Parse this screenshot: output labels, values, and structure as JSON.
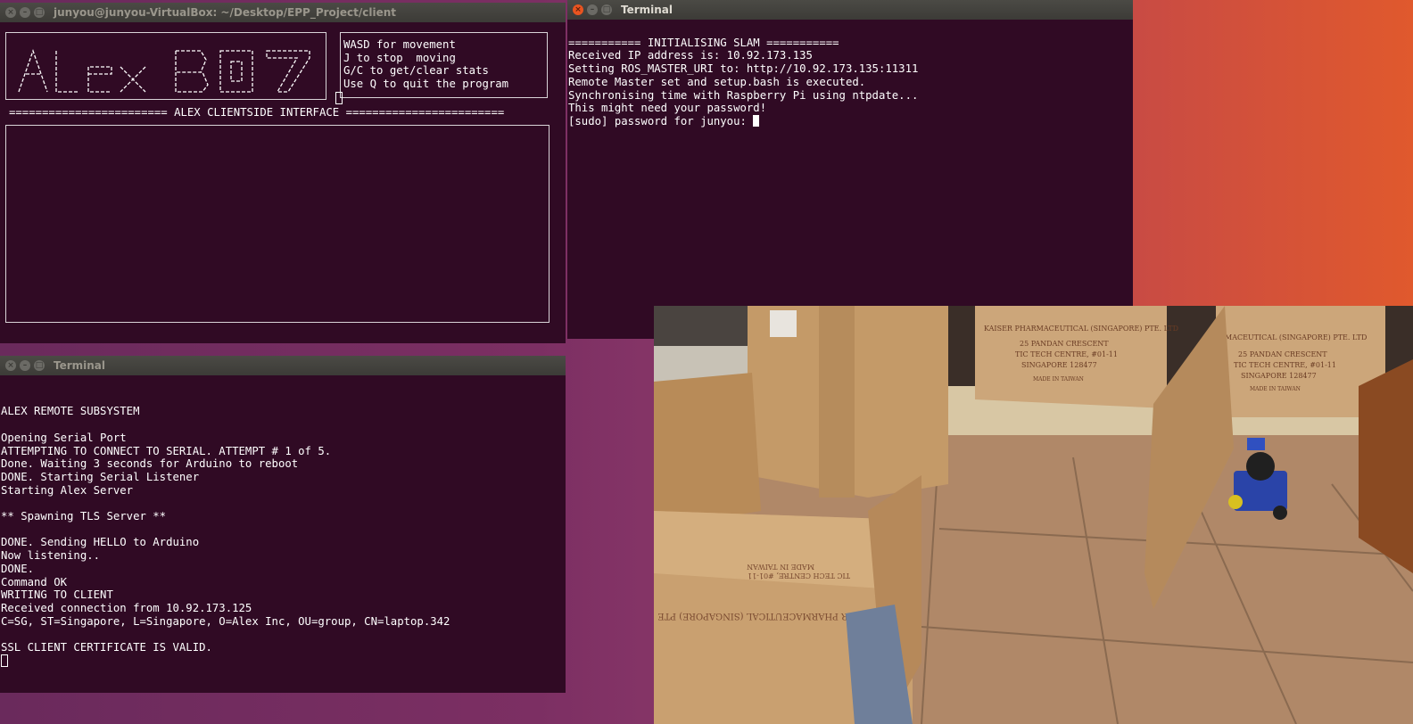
{
  "client_window": {
    "title": "junyou@junyou-VirtualBox: ~/Desktop/EPP_Project/client",
    "banner_ascii": [
      " ___  __            ___  ___  ___ ",
      "/ _ \\|  |   ___ _ _|_  )|   ||_  )",
      "| |_| |  |__/ -_) \\ // / | O | / / ",
      "|_| |_|____\\___/_\\_\\/___||___|/___|"
    ],
    "banner_text": "Alex B07",
    "help_lines": [
      "WASD for movement",
      "J to stop  moving",
      "G/C to get/clear stats",
      "Use Q to quit the program"
    ],
    "interface_header": "======================== ALEX CLIENTSIDE INTERFACE ========================"
  },
  "slam_window": {
    "title": "Terminal",
    "lines": [
      "=========== INITIALISING SLAM ===========",
      "Received IP address is: 10.92.173.135",
      "Setting ROS_MASTER_URI to: http://10.92.173.135:11311",
      "Remote Master set and setup.bash is executed.",
      "Synchronising time with Raspberry Pi using ntpdate...",
      "This might need your password!"
    ],
    "prompt": "[sudo] password for junyou: "
  },
  "server_window": {
    "title": "Terminal",
    "lines": [
      "",
      "ALEX REMOTE SUBSYSTEM",
      "",
      "Opening Serial Port",
      "ATTEMPTING TO CONNECT TO SERIAL. ATTEMPT # 1 of 5.",
      "Done. Waiting 3 seconds for Arduino to reboot",
      "DONE. Starting Serial Listener",
      "Starting Alex Server",
      "",
      "** Spawning TLS Server **",
      "",
      "DONE. Sending HELLO to Arduino",
      "Now listening..",
      "DONE.",
      "Command OK",
      "WRITING TO CLIENT",
      "Received connection from 10.92.173.125",
      "C=SG, ST=Singapore, L=Singapore, O=Alex Inc, OU=group, CN=laptop.342",
      "",
      "SSL CLIENT CERTIFICATE IS VALID."
    ]
  },
  "camera_feed": {
    "box_texts": [
      "KAISER PHARMACEUTICAL (SINGAPORE) PTE. LTD",
      "25 PANDAN CRESCENT",
      "TIC TECH CENTRE, #01-11",
      "SINGAPORE 128477",
      "MADE IN TAIWAN",
      "MACEUTICAL (SINGAPORE) PTE. LTD",
      "KAISER PHARMACEUTICAL (SINGAPORE) PTE"
    ]
  },
  "colors": {
    "terminal_bg": "#300a24",
    "titlebar_bg": "#3c3b37",
    "close_button": "#e95420",
    "desktop_orange": "#e0592d"
  }
}
